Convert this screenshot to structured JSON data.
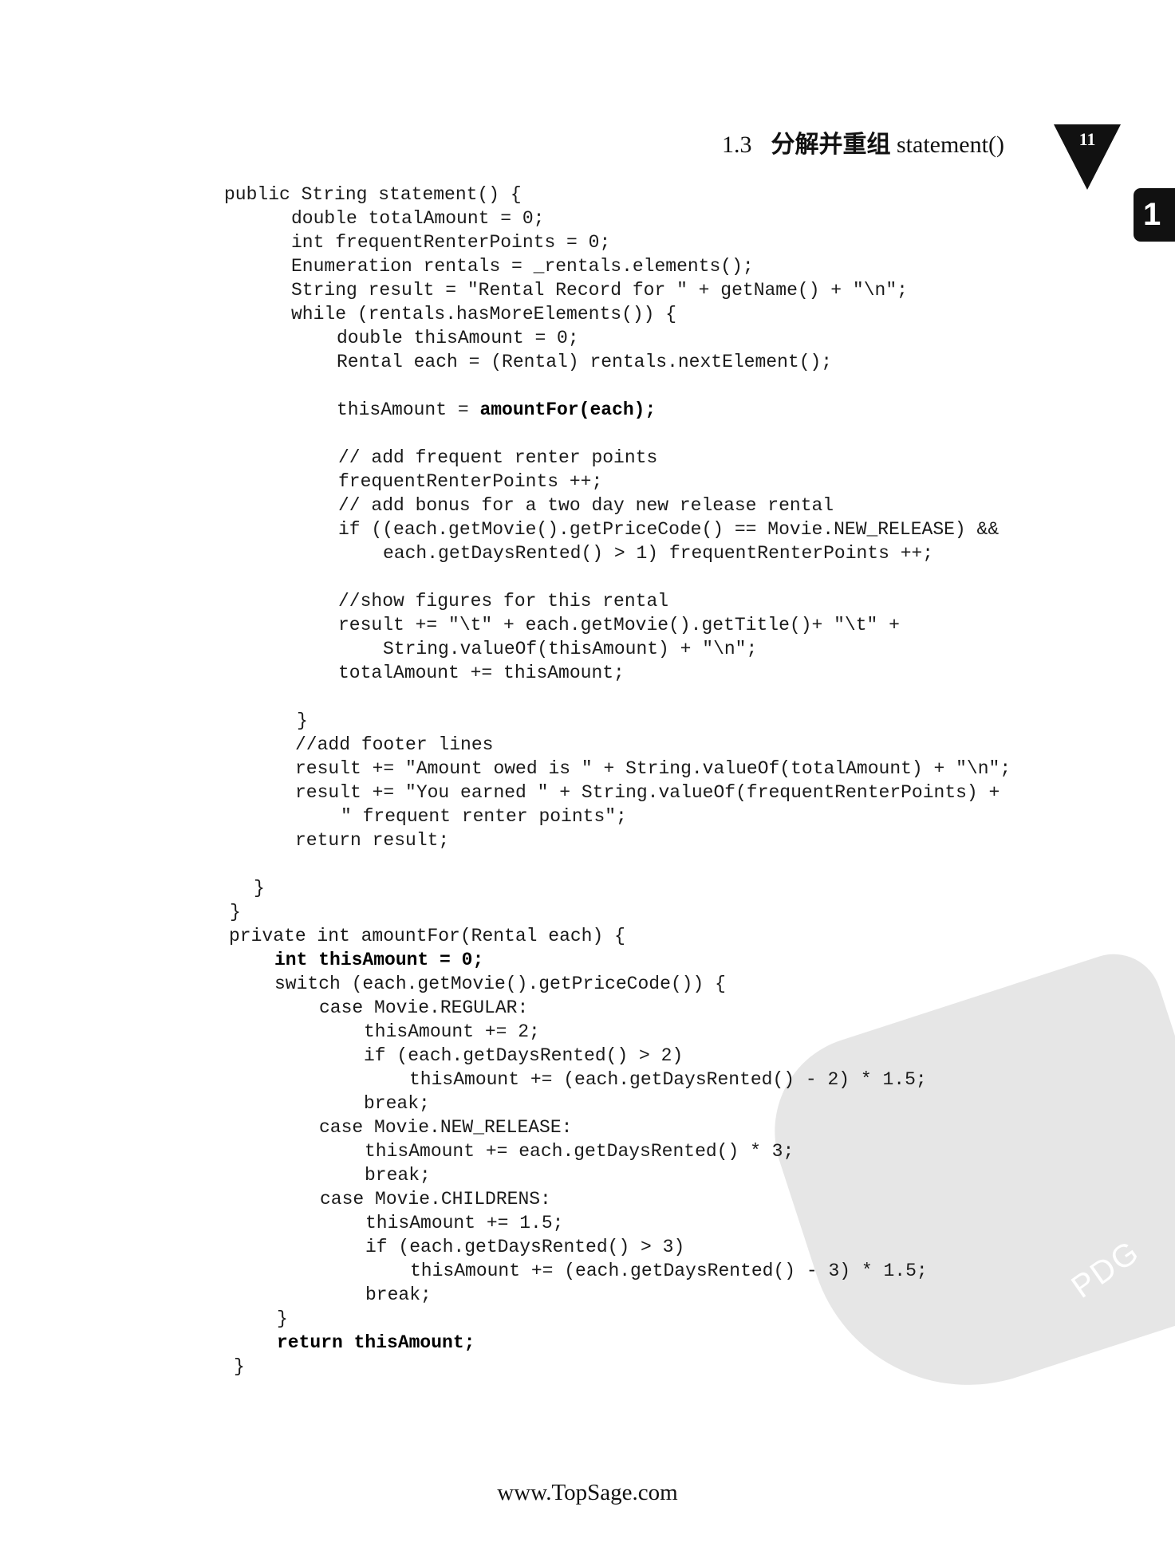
{
  "header": {
    "section_number": "1.3",
    "title_zh": "分解并重组",
    "title_code": "statement()",
    "page_number": "11",
    "chapter_tab": "1"
  },
  "code": {
    "l0": "public String statement() {",
    "l1": "double totalAmount = 0;",
    "l2": "int frequentRenterPoints = 0;",
    "l3": "Enumeration rentals = _rentals.elements();",
    "l4": "String result = \"Rental Record for \" + getName() + \"\\n\";",
    "l5": "while (rentals.hasMoreElements()) {",
    "l6": "double thisAmount = 0;",
    "l7": "Rental each = (Rental) rentals.nextElement();",
    "l9a": "thisAmount = ",
    "l9b": "amountFor(each);",
    "l11": "// add frequent renter points",
    "l12": "frequentRenterPoints ++;",
    "l13": "// add bonus for a two day new release rental",
    "l14": "if ((each.getMovie().getPriceCode() == Movie.NEW_RELEASE) &&",
    "l15": "each.getDaysRented() > 1) frequentRenterPoints ++;",
    "l17": "//show figures for this rental",
    "l18": "result += \"\\t\" + each.getMovie().getTitle()+ \"\\t\" +",
    "l19": "String.valueOf(thisAmount) + \"\\n\";",
    "l20": "totalAmount += thisAmount;",
    "l22": "}",
    "l23": "//add footer lines",
    "l24": "result += \"Amount owed is \" + String.valueOf(totalAmount) + \"\\n\";",
    "l25": "result += \"You earned \" + String.valueOf(frequentRenterPoints) +",
    "l26": "\" frequent renter points\";",
    "l27": "return result;",
    "l29": "}",
    "l30": "}",
    "l31": "private int amountFor(Rental each) {",
    "l32": "int thisAmount = 0;",
    "l33": "switch (each.getMovie().getPriceCode()) {",
    "l34": "case Movie.REGULAR:",
    "l35": "thisAmount += 2;",
    "l36": "if (each.getDaysRented() > 2)",
    "l37": "thisAmount += (each.getDaysRented() - 2) * 1.5;",
    "l38": "break;",
    "l39": "case Movie.NEW_RELEASE:",
    "l40": "thisAmount += each.getDaysRented() * 3;",
    "l41": "break;",
    "l42": "case Movie.CHILDRENS:",
    "l43": "thisAmount += 1.5;",
    "l44": "if (each.getDaysRented() > 3)",
    "l45": "thisAmount += (each.getDaysRented() - 3) * 1.5;",
    "l46": "break;",
    "l47": "}",
    "l48": "return thisAmount;",
    "l49": "}"
  },
  "watermark": {
    "label": "PDG"
  },
  "footer": {
    "url": "www.TopSage.com"
  }
}
